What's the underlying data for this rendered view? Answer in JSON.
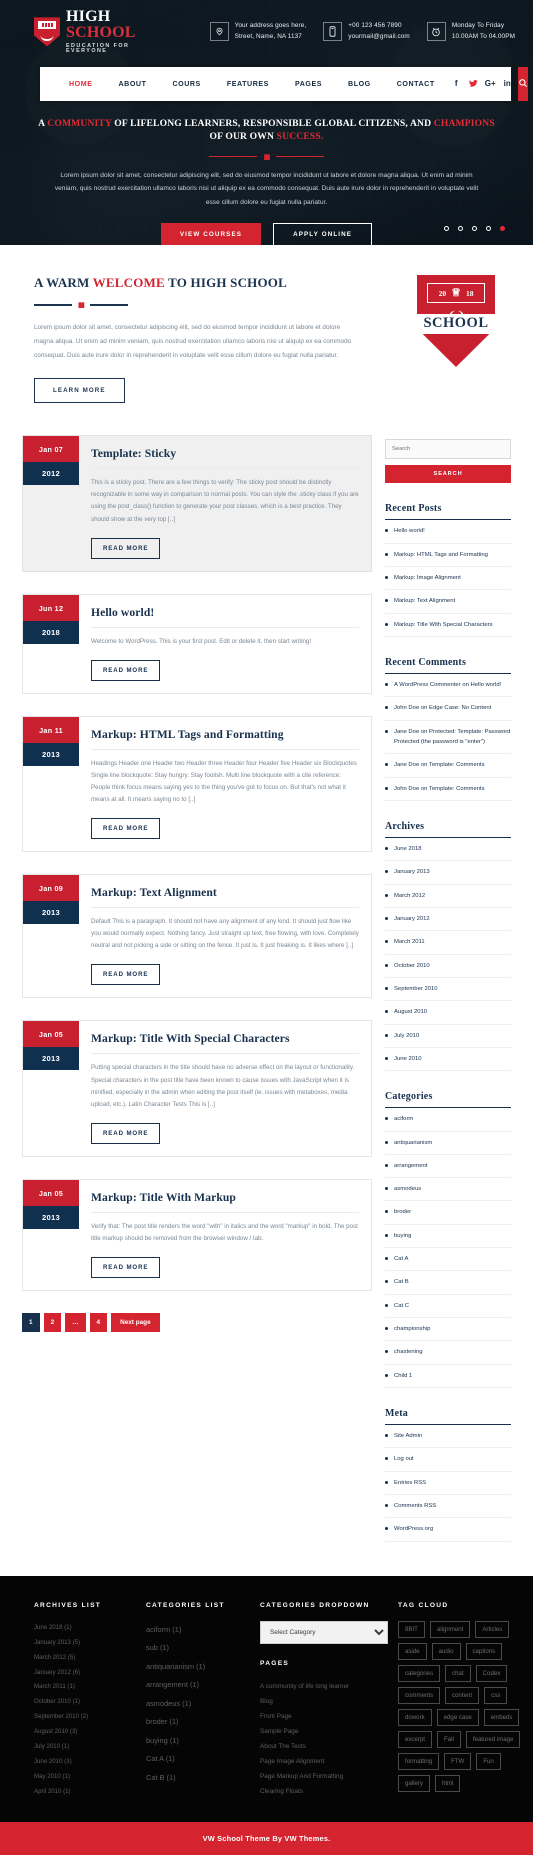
{
  "header": {
    "brand": {
      "word1": "HIGH",
      "word2": "SCHOOL",
      "tagline": "EDUCATION FOR EVERYONE"
    },
    "info": [
      {
        "icon": "location-pin-icon",
        "line1": "Your address goes here,",
        "line2": "Street, Name, NA 1137"
      },
      {
        "icon": "phone-icon",
        "line1": "+00 123 456 7890",
        "line2": "yourmail@gmail.com"
      },
      {
        "icon": "clock-icon",
        "line1": "Monday To Friday",
        "line2": "10.00AM To 04.00PM"
      }
    ],
    "nav": [
      {
        "label": "HOME",
        "active": true
      },
      {
        "label": "ABOUT",
        "active": false
      },
      {
        "label": "COURS",
        "active": false
      },
      {
        "label": "FEATURES",
        "active": false
      },
      {
        "label": "PAGES",
        "active": false
      },
      {
        "label": "BLOG",
        "active": false
      },
      {
        "label": "CONTACT",
        "active": false
      }
    ],
    "social": [
      "f",
      "twitter",
      "G+",
      "in"
    ],
    "search_icon": "search-icon"
  },
  "hero": {
    "title_pre": "A ",
    "title_red1": "COMMUNITY",
    "title_mid": " OF LIFELONG LEARNERS, RESPONSIBLE GLOBAL CITIZENS, AND ",
    "title_red2": "CHAMPIONS",
    "title_mid2": " OF OUR OWN ",
    "title_red3": "SUCCESS.",
    "paragraph": "Lorem ipsum dolor sit amet, consectetur adipiscing elit, sed do eiusmod tempor incididunt ut labore et dolore magna aliqua. Ut enim ad minim veniam, quis nostrud exercitation ullamco laboris nisi ut aliquip ex ea commodo consequat. Duis aute irure dolor in reprehenderit in voluptate velit esse cillum dolore eu fugiat nulla pariatur.",
    "btn_primary": "VIEW COURSES",
    "btn_secondary": "APPLY ONLINE",
    "dots_total": 5,
    "dot_active_index": 4
  },
  "welcome": {
    "title_pre": "A WARM ",
    "title_red": "WELCOME",
    "title_post": " TO HIGH SCHOOL",
    "paragraph": "Lorem ipsum dolor sit amet, consectetur adipiscing elit, sed do eiusmod tempor incididunt ut labore et dolore magna aliqua. Ut enim ad minim veniam, quis nostrud exercitation ullamco laboris nisi ut aliquip ex ea commodo consequat. Duis aute irure dolor in reprehenderit in voluptate velit esse cillum dolore eu fugiat nulla pariatur.",
    "button": "LEARN MORE",
    "badge": {
      "left": "20",
      "right": "18",
      "name": "SCHOOL",
      "crown_icon": "crown-icon"
    }
  },
  "posts": [
    {
      "day": "Jan 07",
      "year": "2012",
      "sticky": true,
      "title": "Template: Sticky",
      "excerpt": "This is a sticky post. There are a few things to verify: The sticky post should be distinctly recognizable in some way in comparison to normal posts. You can style the .sticky class if you are using the post_class() function to generate your post classes, which is a best practice. They should show at the very top [..]",
      "button": "READ MORE"
    },
    {
      "day": "Jun 12",
      "year": "2018",
      "sticky": false,
      "title": "Hello world!",
      "excerpt": "Welcome to WordPress. This is your first post. Edit or delete it, then start writing!",
      "button": "READ MORE"
    },
    {
      "day": "Jan 11",
      "year": "2013",
      "sticky": false,
      "title": "Markup: HTML Tags and Formatting",
      "excerpt": "Headings Header one Header two Header three Header four Header five Header six Blockquotes Single line blockquote: Stay hungry. Stay foolish. Multi line blockquote with a cite reference: People think focus means saying yes to the thing you've got to focus on. But that's not what it means at all. It means saying no to [..]",
      "button": "READ MORE"
    },
    {
      "day": "Jan 09",
      "year": "2013",
      "sticky": false,
      "title": "Markup: Text Alignment",
      "excerpt": "Default This is a paragraph. It should not have any alignment of any kind. It should just flow like you would normally expect. Nothing fancy. Just straight up text, free flowing, with love. Completely neutral and not picking a side or sitting on the fence. It just is. It just freaking is. It likes where [..]",
      "button": "READ MORE"
    },
    {
      "day": "Jan 05",
      "year": "2013",
      "sticky": false,
      "title": "Markup: Title With Special Characters",
      "excerpt": "Putting special characters in the title should have no adverse effect on the layout or functionality. Special characters in the post title have been known to cause issues with JavaScript when it is minified, especially in the admin when editing the post itself (ie. issues with metaboxes, media upload, etc.). Latin Character Tests This is [..]",
      "button": "READ MORE"
    },
    {
      "day": "Jan 05",
      "year": "2013",
      "sticky": false,
      "title": "Markup: Title With Markup",
      "excerpt": "Verify that: The post title renders the word \"with\" in italics and the word \"markup\" in bold. The post title markup should be removed from the browser window / tab.",
      "button": "READ MORE"
    }
  ],
  "pagination": {
    "pages": [
      "1",
      "2",
      "…",
      "4"
    ],
    "current": "1",
    "next_label": "Next page"
  },
  "sidebar": {
    "search": {
      "placeholder": "Search",
      "button": "SEARCH"
    },
    "recent_posts": {
      "title": "Recent Posts",
      "items": [
        "Hello world!",
        "Markup: HTML Tags and Formatting",
        "Markup: Image Alignment",
        "Markup: Text Alignment",
        "Markup: Title With Special Characters"
      ]
    },
    "recent_comments": {
      "title": "Recent Comments",
      "items": [
        "A WordPress Commenter on Hello world!",
        "John Doe on Edge Case: No Content",
        "Jane Doe on Protected: Template: Password Protected (the password is \"enter\")",
        "Jane Doe on Template: Comments",
        "John Doe on Template: Comments"
      ]
    },
    "archives": {
      "title": "Archives",
      "items": [
        "June 2018",
        "January 2013",
        "March 2012",
        "January 2012",
        "March 2011",
        "October 2010",
        "September 2010",
        "August 2010",
        "July 2010",
        "June 2010"
      ]
    },
    "categories": {
      "title": "Categories",
      "items": [
        "aciform",
        "antiquarianism",
        "arrangement",
        "asmodeus",
        "broder",
        "buying",
        "Cat A",
        "Cat B",
        "Cat C",
        "championship",
        "chastening",
        "Child 1"
      ]
    },
    "meta": {
      "title": "Meta",
      "items": [
        "Site Admin",
        "Log out",
        "Entries RSS",
        "Comments RSS",
        "WordPress.org"
      ]
    }
  },
  "footer": {
    "archives_list": {
      "title": "ARCHIVES LIST",
      "items": [
        "June 2018 (1)",
        "January 2013 (5)",
        "March 2012 (5)",
        "January 2012 (6)",
        "March 2011 (1)",
        "October 2010 (1)",
        "September 2010 (2)",
        "August 2010 (3)",
        "July 2010 (1)",
        "June 2010 (3)",
        "May 2010 (1)",
        "April 2010 (1)"
      ]
    },
    "categories_list": {
      "title": "CATEGORIES LIST",
      "items": [
        "aciform (1)",
        "sub (1)",
        "antiquarianism (1)",
        "arrangement (1)",
        "asmodeus (1)",
        "broder (1)",
        "buying (1)",
        "Cat A (1)",
        "Cat B (1)"
      ]
    },
    "categories_dropdown": {
      "title": "CATEGORIES DROPDOWN",
      "selected": "Select Category",
      "options": [
        "Select Category"
      ]
    },
    "pages": {
      "title": "PAGES",
      "items": [
        "A community of life long learner",
        "Blog",
        "Front Page",
        "Sample Page",
        "About The Tests",
        "Page Image Alignment",
        "Page Markup And Formatting",
        "Clearing Floats"
      ]
    },
    "tag_cloud": {
      "title": "TAG CLOUD",
      "tags": [
        "8BIT",
        "alignment",
        "Articles",
        "aside",
        "audio",
        "captions",
        "categories",
        "chat",
        "Codex",
        "comments",
        "content",
        "css",
        "dowork",
        "edge case",
        "embeds",
        "excerpt",
        "Fail",
        "featured image",
        "formatting",
        "FTW",
        "Fun",
        "gallery",
        "html"
      ]
    },
    "copyright": "VW School Theme By VW Themes."
  },
  "colors": {
    "brand_red": "#d32430",
    "navy": "#16304d",
    "dark": "#050505"
  }
}
